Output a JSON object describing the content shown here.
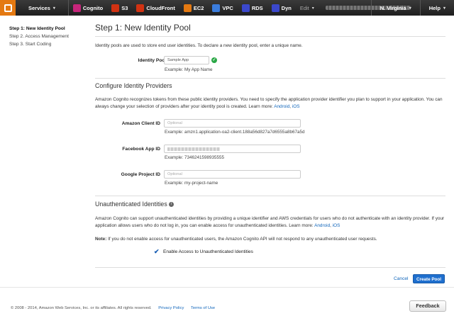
{
  "nav": {
    "services_label": "Services",
    "items": [
      {
        "label": "Cognito",
        "color": "#c7257b"
      },
      {
        "label": "S3",
        "color": "#d13212"
      },
      {
        "label": "CloudFront",
        "color": "#d13212"
      },
      {
        "label": "EC2",
        "color": "#e47911"
      },
      {
        "label": "VPC",
        "color": "#3b7ddd"
      },
      {
        "label": "RDS",
        "color": "#3b48cc"
      },
      {
        "label": "Dyn",
        "color": "#3b48cc"
      }
    ],
    "edit_label": "Edit",
    "region_label": "N. Virginia",
    "help_label": "Help"
  },
  "steps": [
    "Step 1: New Identity Pool",
    "Step 2. Access Management",
    "Step 3. Start Coding"
  ],
  "page": {
    "title": "Step 1: New Identity Pool",
    "intro": "Identity pools are used to store end user identities. To declare a new identity pool, enter a unique name."
  },
  "pool_name": {
    "label": "Identity Pool Name",
    "value": "Sample App",
    "example": "Example: My App Name"
  },
  "providers": {
    "heading": "Configure Identity Providers",
    "desc": "Amazon Cognito recognizes tokens from these public identity providers. You need to specify the application provider identifier you plan to support in your application. You can always change your selection of providers after your identity pool is created. Learn more:",
    "link_android": "Android",
    "link_ios": "iOS",
    "amazon": {
      "label": "Amazon Client ID",
      "placeholder": "Optional",
      "example": "Example: amzn1.application-oa2-client.188a56d827a7d6555a8b67a5d"
    },
    "facebook": {
      "label": "Facebook App ID",
      "example": "Example: 7346241598935555"
    },
    "google": {
      "label": "Google Project ID",
      "placeholder": "Optional",
      "example": "Example: my-project-name"
    }
  },
  "unauth": {
    "heading": "Unauthenticated Identities",
    "desc": "Amazon Cognito can support unauthenticated identities by providing a unique identifier and AWS credentials for users who do not authenticate with an identity provider. If your application allows users who do not log in, you can enable access for unauthenticated identities. Learn more:",
    "link_android": "Android",
    "link_ios": "iOS",
    "note_label": "Note:",
    "note": "If you do not enable access for unauthenticated users, the Amazon Cognito API will not respond to any unauthenticated user requests.",
    "checkbox_label": "Enable Access to Unauthenticated Identities",
    "checked": true
  },
  "actions": {
    "cancel": "Cancel",
    "create": "Create Pool"
  },
  "footer": {
    "copyright": "© 2008 - 2014, Amazon Web Services, Inc. or its affiliates. All rights reserved.",
    "privacy": "Privacy Policy",
    "terms": "Terms of Use",
    "feedback": "Feedback"
  }
}
